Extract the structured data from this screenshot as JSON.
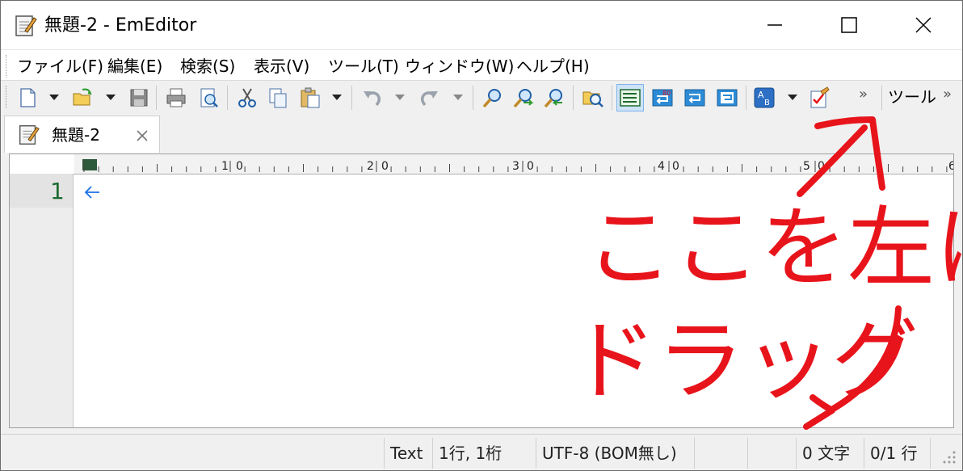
{
  "window": {
    "title": "無題-2 - EmEditor"
  },
  "menu": [
    "ファイル(F)",
    "編集(E)",
    "検索(S)",
    "表示(V)",
    "ツール(T)",
    "ウィンドウ(W)",
    "ヘルプ(H)"
  ],
  "toolbar": {
    "more_glyph": "»",
    "tools_label": "ツール",
    "tools_more_glyph": "»",
    "icons": [
      "new-file-icon",
      "open-folder-icon",
      "save-icon",
      "print-icon",
      "print-preview-icon",
      "cut-icon",
      "copy-icon",
      "paste-icon",
      "undo-icon",
      "redo-icon",
      "find-icon",
      "find-next-icon",
      "find-previous-icon",
      "find-in-files-icon",
      "wrap-none-icon",
      "wrap-by-chars-icon",
      "wrap-by-window-icon",
      "wrap-by-page-icon",
      "spell-check-icon",
      "customize-icon"
    ]
  },
  "tab": {
    "label": "無題-2",
    "close_glyph": "×"
  },
  "ruler": {
    "labels": [
      "1",
      "0",
      "2",
      "0",
      "3",
      "0",
      "4",
      "0",
      "5",
      "0",
      "6"
    ]
  },
  "editor": {
    "line_number": "1",
    "eol_mark": "←"
  },
  "status": {
    "mode": "Text",
    "position": "1行, 1桁",
    "encoding": "UTF-8 (BOM無し)",
    "char_count": "0 文字",
    "line_count": "0/1 行"
  },
  "annotation": {
    "line1": "ここを左に",
    "line2": "ドラッグ",
    "color": "#e8141b"
  },
  "colors": {
    "accent": "#1e6b2e",
    "selected_button": "#cde3f7",
    "annotation_red": "#e8141b"
  }
}
